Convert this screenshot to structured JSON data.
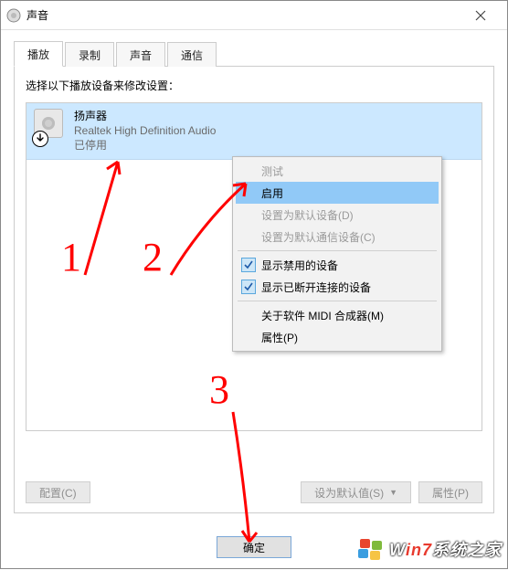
{
  "window": {
    "title": "声音"
  },
  "tabs": [
    {
      "label": "播放",
      "active": true
    },
    {
      "label": "录制",
      "active": false
    },
    {
      "label": "声音",
      "active": false
    },
    {
      "label": "通信",
      "active": false
    }
  ],
  "panel": {
    "instruction": "选择以下播放设备来修改设置：",
    "device": {
      "name": "扬声器",
      "subtitle": "Realtek High Definition Audio",
      "status": "已停用",
      "icon": "speaker-icon",
      "overlay": "down-arrow-overlay"
    },
    "context_menu": {
      "items": [
        {
          "label": "测试",
          "state": "disabled"
        },
        {
          "label": "启用",
          "state": "highlight"
        },
        {
          "label": "设置为默认设备(D)",
          "state": "disabled"
        },
        {
          "label": "设置为默认通信设备(C)",
          "state": "disabled"
        },
        {
          "separator": true
        },
        {
          "label": "显示禁用的设备",
          "state": "checked"
        },
        {
          "label": "显示已断开连接的设备",
          "state": "checked"
        },
        {
          "separator": true
        },
        {
          "label": "关于软件 MIDI 合成器(M)",
          "state": "normal"
        },
        {
          "label": "属性(P)",
          "state": "normal"
        }
      ]
    },
    "buttons": {
      "configure": "配置(C)",
      "set_default": "设为默认值(S)",
      "properties": "属性(P)"
    }
  },
  "footer": {
    "ok": "确定"
  },
  "annotations": {
    "n1": "1",
    "n2": "2",
    "n3": "3"
  },
  "watermark": {
    "brand_prefix": "W",
    "brand_seven": "in7",
    "brand_rest": "系统之家"
  }
}
